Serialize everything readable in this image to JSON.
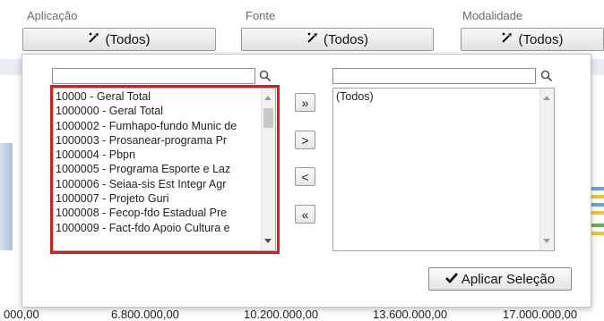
{
  "filters": [
    {
      "label": "Aplicação",
      "value": "(Todos)"
    },
    {
      "label": "Fonte",
      "value": "(Todos)"
    },
    {
      "label": "Modalidade",
      "value": "(Todos)"
    }
  ],
  "dialog": {
    "available": {
      "search_value": "",
      "items": [
        "10000 - Geral Total",
        "1000000 - Geral Total",
        "1000002 - Fumhapo-fundo Munic de",
        "1000003 - Prosanear-programa Pr",
        "1000004 - Pbpn",
        "1000005 - Programa Esporte e Laz",
        "1000006 - Seiaa-sis Est Integr Agr",
        "1000007 - Projeto Guri",
        "1000008 - Fecop-fdo Estadual Pre",
        "1000009 - Fact-fdo Apoio Cultura e"
      ]
    },
    "move_buttons": {
      "add_all": "»",
      "add": ">",
      "remove": "<",
      "remove_all": "«"
    },
    "selected": {
      "search_value": "",
      "items": [
        "(Todos)"
      ]
    },
    "apply_label": "Aplicar Seleção"
  },
  "axis_labels": [
    "000,00",
    "6.800.000,00",
    "10.200.000,00",
    "13.600.000,00",
    "17.000.000,00"
  ],
  "colors": {
    "highlight": "#e31919",
    "stripe_blue": "#6fa0d8",
    "stripe_yellow": "#f2c230",
    "stripe_green": "#6ab04c"
  },
  "icons": [
    "clear-filter-icon",
    "search-icon",
    "checkmark-icon"
  ]
}
